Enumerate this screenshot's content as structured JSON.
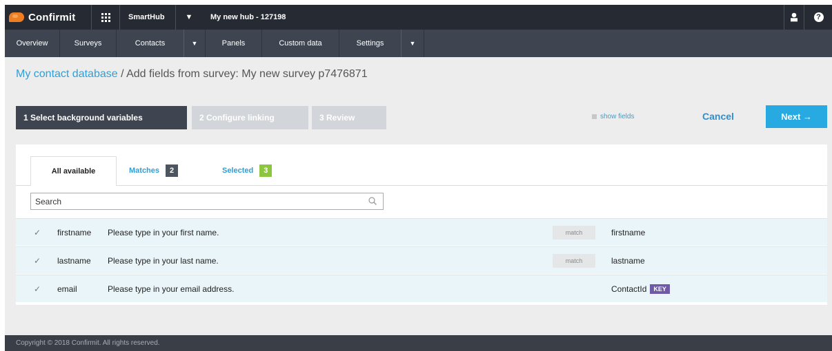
{
  "topbar": {
    "logo_text": "Confirmit",
    "apps_icon": "grid-icon",
    "hub_label": "SmartHub",
    "hub_title": "My new hub - 127198",
    "user_icon": "user-icon",
    "help_icon": "help-icon",
    "help_glyph": "?"
  },
  "nav": {
    "items": [
      {
        "label": "Overview"
      },
      {
        "label": "Surveys"
      },
      {
        "label": "Contacts"
      },
      {
        "label": "Panels"
      },
      {
        "label": "Custom data"
      },
      {
        "label": "Settings"
      }
    ],
    "dropdown_glyph": "▼"
  },
  "breadcrumb": {
    "link": "My contact database",
    "separator": " / ",
    "current": "Add fields from survey: My new survey p7476871"
  },
  "wizard": {
    "steps": [
      {
        "label": "1 Select background variables",
        "state": "active"
      },
      {
        "label": "2 Configure linking",
        "state": "disabled"
      },
      {
        "label": "3 Review",
        "state": "disabled"
      }
    ],
    "show_fields": "show fields",
    "cancel": "Cancel",
    "next": "Next →"
  },
  "tabs": {
    "all": "All available",
    "matches": "Matches",
    "matches_count": "2",
    "selected": "Selected",
    "selected_count": "3"
  },
  "search": {
    "placeholder": "Search"
  },
  "rows": [
    {
      "checked": "✓",
      "name": "firstname",
      "text": "Please type in your first name.",
      "match": "match",
      "target": "firstname",
      "key": ""
    },
    {
      "checked": "✓",
      "name": "lastname",
      "text": "Please type in your last name.",
      "match": "match",
      "target": "lastname",
      "key": ""
    },
    {
      "checked": "✓",
      "name": "email",
      "text": "Please type in your email address.",
      "match": "",
      "target": "ContactId",
      "key": "KEY"
    }
  ],
  "footer": {
    "text": "Copyright © 2018 Confirmit. All rights reserved."
  },
  "colors": {
    "accent": "#27a9e1",
    "topbar": "#262b33",
    "navbar": "#3e4550",
    "selected_badge": "#8cc63f",
    "key_badge": "#6e5aa7"
  }
}
